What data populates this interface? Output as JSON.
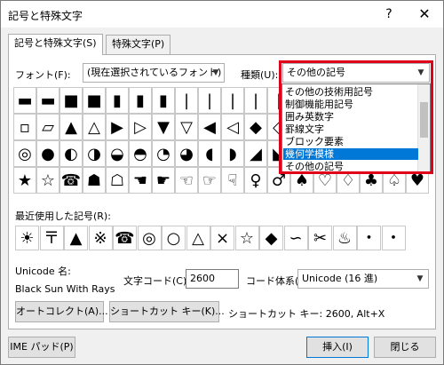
{
  "window": {
    "title": "記号と特殊文字",
    "help": "?",
    "close": "✕"
  },
  "tabs": [
    {
      "label": "記号と特殊文字(S)"
    },
    {
      "label": "特殊文字(P)"
    }
  ],
  "font": {
    "label": "フォント(F):",
    "value": "(現在選択されているフォント)"
  },
  "subset": {
    "label": "種類(U):",
    "value": "その他の記号",
    "options": [
      "その他の技術用記号",
      "制御機能用記号",
      "囲み英数字",
      "罫線文字",
      "ブロック要素",
      "幾何学模様",
      "その他の記号"
    ],
    "selected_index": 5
  },
  "symbols": [
    [
      "▬",
      "▬",
      "■",
      "■",
      "▮",
      "▮",
      "▮",
      "|",
      "|",
      "|",
      "|",
      "|",
      "▬",
      "▬",
      "▬",
      "▬",
      "▬",
      "▬"
    ],
    [
      "▫",
      "▱",
      "▲",
      "△",
      "▶",
      "▷",
      "▼",
      "▽",
      "◀",
      "◁",
      "◆",
      "◇",
      "◈",
      "○",
      "◌",
      "◎",
      "●",
      "◐"
    ],
    [
      "◎",
      "●",
      "◐",
      "◑",
      "◒",
      "◓",
      "◔",
      "◕",
      "◖",
      "◗",
      "◢",
      "◣",
      "◤",
      "◥",
      "◦",
      "◯",
      "◰",
      "◱"
    ],
    [
      "★",
      "☆",
      "☎",
      "☗",
      "☖",
      "☚",
      "☛",
      "☜",
      "☞",
      "☟",
      "♀",
      "♂",
      "♠",
      "♡",
      "♢",
      "♣",
      "♤",
      "♥"
    ]
  ],
  "recent": {
    "label": "最近使用した記号(R):",
    "items": [
      "☀",
      "〒",
      "▲",
      "※",
      "☎",
      "◎",
      "○",
      "△",
      "×",
      "☆",
      "◆",
      "∽",
      "✂",
      "♨",
      "・",
      "・"
    ]
  },
  "unicode": {
    "label": "Unicode 名:",
    "name": "Black Sun With Rays"
  },
  "char_code": {
    "label": "文字コード(C):",
    "value": "2600"
  },
  "code_system": {
    "label": "コード体系(M):",
    "value": "Unicode (16 進)"
  },
  "buttons": {
    "autocorrect": "オートコレクト(A)...",
    "shortcut": "ショートカット キー(K)...",
    "shortcut_info": "ショートカット キー: 2600, Alt+X",
    "ime": "IME パッド(P)",
    "insert": "挿入(I)",
    "close": "閉じる"
  }
}
